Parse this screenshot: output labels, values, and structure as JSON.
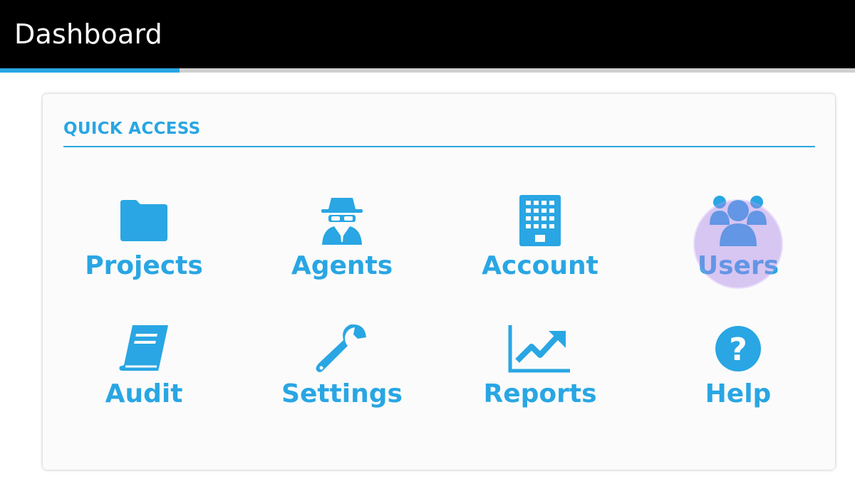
{
  "header": {
    "title": "Dashboard"
  },
  "progress": {
    "fraction": 0.21,
    "color": "#29a6e3"
  },
  "quick_access": {
    "heading": "QUICK ACCESS",
    "accent": "#29a6e3",
    "tiles": [
      {
        "label": "Projects",
        "icon": "folder-icon"
      },
      {
        "label": "Agents",
        "icon": "spy-icon"
      },
      {
        "label": "Account",
        "icon": "building-icon"
      },
      {
        "label": "Users",
        "icon": "users-icon"
      },
      {
        "label": "Audit",
        "icon": "book-icon"
      },
      {
        "label": "Settings",
        "icon": "wrench-icon"
      },
      {
        "label": "Reports",
        "icon": "line-chart-icon"
      },
      {
        "label": "Help",
        "icon": "question-circle-icon"
      }
    ]
  }
}
